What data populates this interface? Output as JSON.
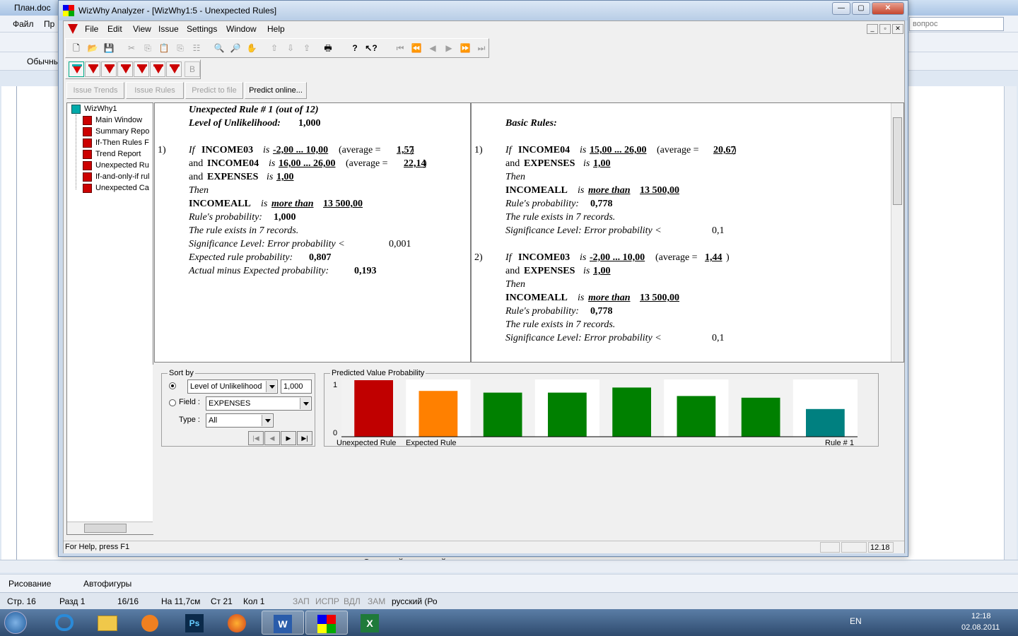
{
  "word": {
    "title": "План.doc",
    "menu": [
      "Файл",
      "Пр"
    ],
    "style_box": "Обычный",
    "help_box": "вопрос",
    "draw_label": "Рисование",
    "autoshapes_label": "Автофигуры",
    "status": {
      "page": "Стр. 16",
      "section": "Разд 1",
      "pages": "16/16",
      "at": "На 11,7см",
      "line": "Ст 21",
      "col": "Кол 1",
      "rec": "ЗАП",
      "trk": "ИСПР",
      "ext": "ВДЛ",
      "ovr": "ЗАМ",
      "lang": "русский (Ро"
    },
    "doc_fragment": "вы с правилу  Отчетной к которой перечисляются правила"
  },
  "app": {
    "title": "WizWhy Analyzer - [WizWhy1:5 - Unexpected Rules]",
    "menu": [
      "File",
      "Edit",
      "View",
      "Issue",
      "Settings",
      "Window",
      "Help"
    ],
    "tabs": [
      "Issue Trends",
      "Issue Rules",
      "Predict to file",
      "Predict online..."
    ],
    "tree": {
      "root": "WizWhy1",
      "items": [
        "Main Window",
        "Summary Repo",
        "If-Then Rules F",
        "Trend Report",
        "Unexpected Ru",
        "If-and-only-if rul",
        "Unexpected Ca"
      ]
    },
    "left_panel": {
      "heading": "Unexpected Rule # 1  (out of  12)",
      "level_label": "Level of Unlikelihood:",
      "level_value": "1,000",
      "num": "1)",
      "if_word": "If",
      "cond1_field": "INCOME03",
      "is": "is",
      "cond1_range": "-2,00 ... 10,00",
      "cond1_avg_label": "(average =",
      "cond1_avg": "1,57",
      "close": ")",
      "and": "and",
      "cond2_field": "INCOME04",
      "cond2_range": "16,00 ... 26,00",
      "cond2_avg": "22,14",
      "cond3_field": "EXPENSES",
      "cond3_val": "1,00",
      "then": "Then",
      "concl_field": "INCOMEALL",
      "concl_val": "more than",
      "concl_num": "13 500,00",
      "prob_label": "Rule's probability:",
      "prob_value": "1,000",
      "records": "The rule exists in 7 records.",
      "sig_label": "Significance Level:   Error probability <",
      "sig_value": "0,001",
      "exp_label": "Expected rule probability:",
      "exp_value": "0,807",
      "diff_label": "Actual minus Expected probability:",
      "diff_value": "0,193"
    },
    "right_panel": {
      "heading": "Basic Rules:",
      "rules": [
        {
          "num": "1)",
          "field": "INCOME04",
          "range": "15,00 ... 26,00",
          "avg": "20,67",
          "and_field": "EXPENSES",
          "and_val": "1,00",
          "concl_field": "INCOMEALL",
          "concl_val": "more than",
          "concl_num": "13 500,00",
          "prob": "0,778",
          "records": "The rule exists in 7 records.",
          "sig": "0,1"
        },
        {
          "num": "2)",
          "field": "INCOME03",
          "range": "-2,00 ... 10,00",
          "avg": "1,44",
          "and_field": "EXPENSES",
          "and_val": "1,00",
          "concl_field": "INCOMEALL",
          "concl_val": "more than",
          "concl_num": "13 500,00",
          "prob": "0,778",
          "records": "The rule exists in 7 records.",
          "sig": "0,1"
        }
      ]
    },
    "sort": {
      "title": "Sort by",
      "combo1": "Level of Unlikelihood",
      "value": "1,000",
      "field_label": "Field :",
      "field_value": "EXPENSES",
      "type_label": "Type :",
      "type_value": "All"
    },
    "chart_title": "Predicted Value Probability",
    "statusbar": {
      "help": "For Help, press F1",
      "time": "12.18"
    }
  },
  "chart_data": {
    "type": "bar",
    "title": "Predicted Value Probability",
    "ylim": [
      0,
      1
    ],
    "yticks": [
      "1",
      "0"
    ],
    "xlabels": [
      "Unexpected Rule",
      "Expected Rule",
      "Rule # 1"
    ],
    "values": [
      1.0,
      0.81,
      0.78,
      0.78,
      0.87,
      0.72,
      0.69,
      0.49
    ],
    "colors": [
      "#c00000",
      "#ff8000",
      "#008000",
      "#008000",
      "#008000",
      "#008000",
      "#008000",
      "#008080"
    ]
  },
  "taskbar": {
    "lang": "EN",
    "time": "12:18",
    "date": "02.08.2011"
  }
}
